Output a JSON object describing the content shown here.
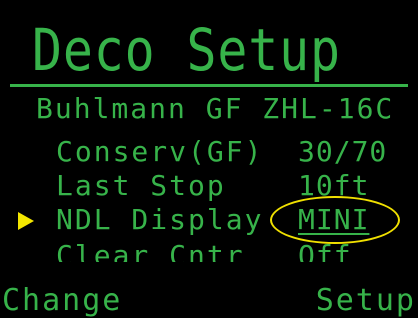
{
  "header": {
    "title": "Deco Setup"
  },
  "algorithm": {
    "label": "Buhlmann GF ZHL-16C"
  },
  "settings": [
    {
      "label": "Conserv(GF)",
      "value": "30/70"
    },
    {
      "label": "Last Stop",
      "value": "10ft"
    },
    {
      "label": "NDL Display",
      "value": "MINI"
    },
    {
      "label": "Clear Cntr",
      "value": "Off"
    }
  ],
  "footer": {
    "left_label": "Change",
    "right_label": "Setup"
  },
  "colors": {
    "text": "#37b34a",
    "cursor": "#f3e600",
    "highlight": "#f0e000",
    "background": "#000000"
  },
  "selected_index": 2
}
